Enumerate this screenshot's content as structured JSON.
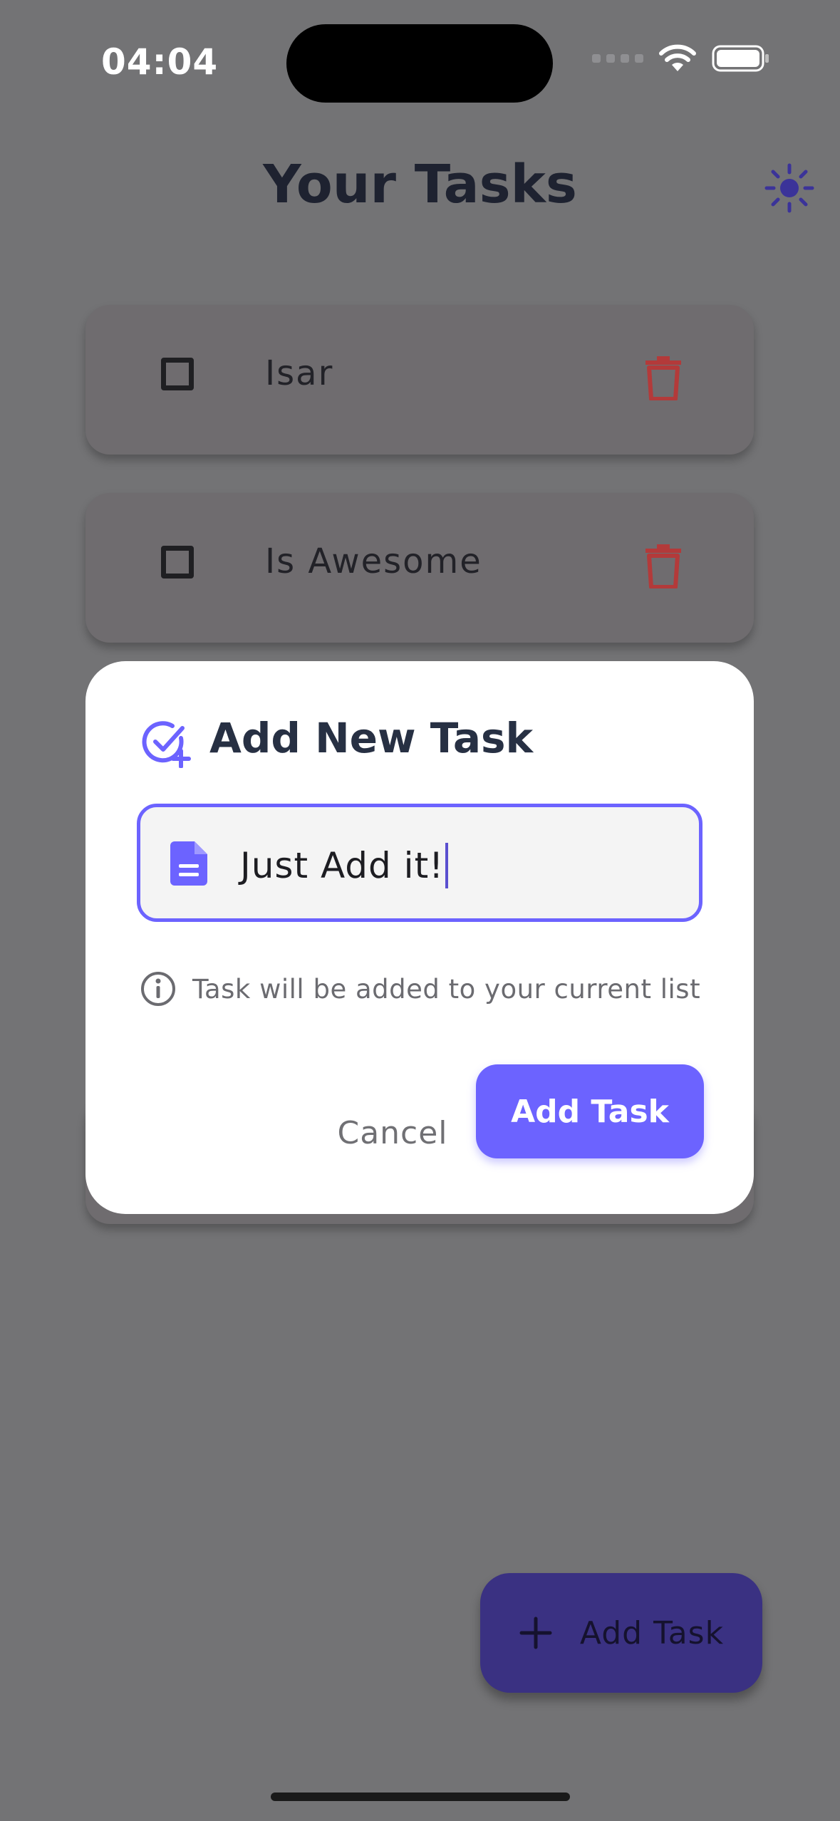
{
  "status_bar": {
    "time": "04:04"
  },
  "header": {
    "title": "Your Tasks",
    "theme_icon": "sun-icon"
  },
  "tasks": [
    {
      "label": "Isar",
      "completed": false
    },
    {
      "label": "Is Awesome",
      "completed": false
    }
  ],
  "dialog": {
    "title": "Add New Task",
    "title_icon": "add-task-icon",
    "input_icon": "document-icon",
    "input_value": "Just Add it!",
    "info_text": "Task will be added to your current list",
    "cancel_label": "Cancel",
    "confirm_label": "Add Task"
  },
  "fab": {
    "label": "Add Task",
    "icon": "plus-icon"
  },
  "colors": {
    "accent": "#6c63ff",
    "delete": "#b33a3a",
    "overlay": "#737375"
  }
}
